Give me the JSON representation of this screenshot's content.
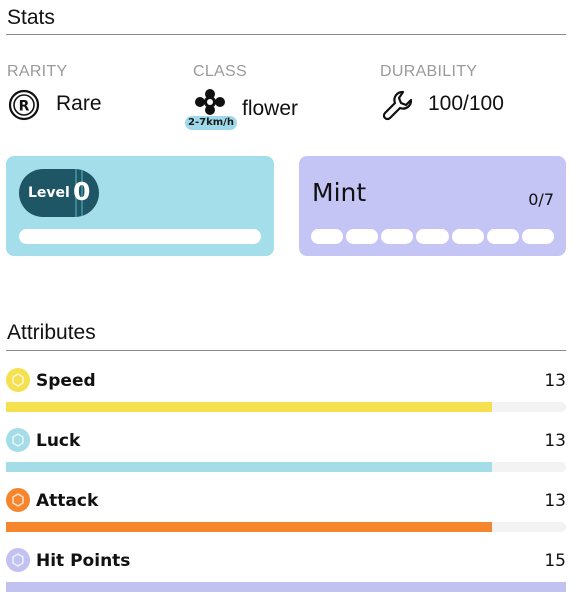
{
  "stats": {
    "title": "Stats",
    "rarity": {
      "label": "RARITY",
      "value": "Rare",
      "icon": "rarity-r-icon"
    },
    "class": {
      "label": "CLASS",
      "value": "flower",
      "badge": "2-7km/h",
      "icon": "flower-icon"
    },
    "durability": {
      "label": "DURABILITY",
      "value": "100/100",
      "icon": "wrench-icon"
    }
  },
  "level_card": {
    "label": "Level",
    "value": "0",
    "progress": 0,
    "color": "#a3deea",
    "badge_color": "#1f5665"
  },
  "mint_card": {
    "label": "Mint",
    "count": "0/7",
    "segments": 7,
    "filled": 0,
    "color": "#c5c5f5"
  },
  "attributes": {
    "title": "Attributes",
    "items": [
      {
        "name": "Speed",
        "value": "13",
        "color": "#f5e050",
        "fill": 0.867
      },
      {
        "name": "Luck",
        "value": "13",
        "color": "#a4dce8",
        "fill": 0.867
      },
      {
        "name": "Attack",
        "value": "13",
        "color": "#f5862d",
        "fill": 0.867
      },
      {
        "name": "Hit Points",
        "value": "15",
        "color": "#c2c2f2",
        "fill": 1.0
      }
    ]
  }
}
